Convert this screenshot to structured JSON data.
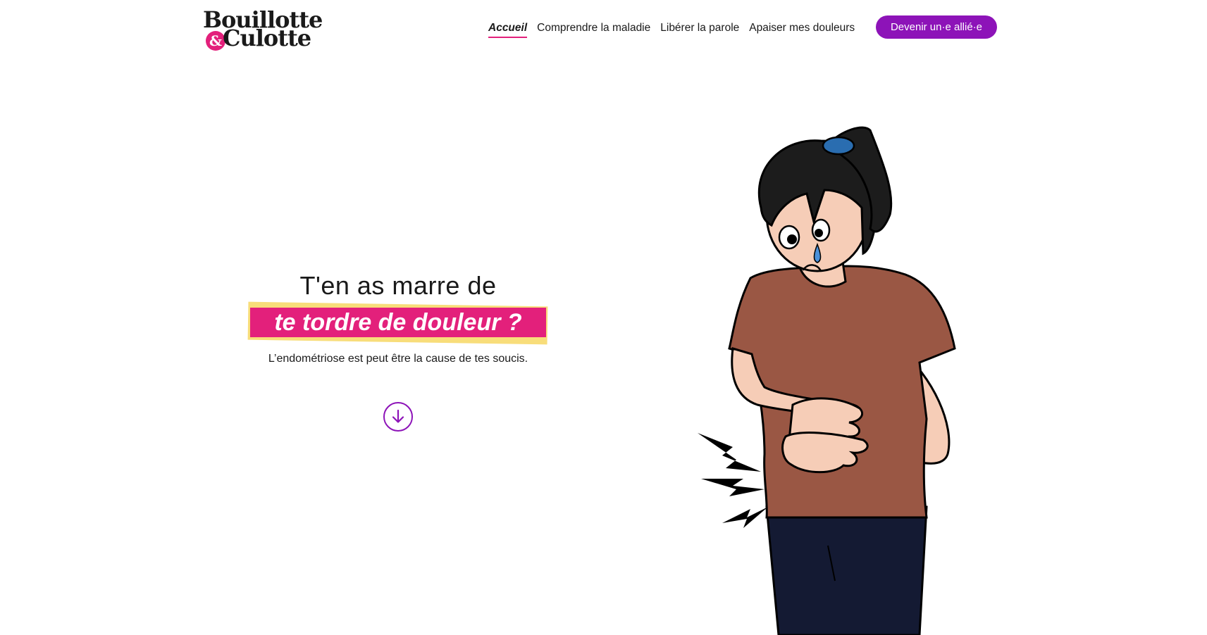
{
  "header": {
    "logo": {
      "line1": "Bouillotte",
      "amp": "&",
      "line2": "Culotte"
    },
    "nav": [
      {
        "label": "Accueil",
        "active": true
      },
      {
        "label": "Comprendre la maladie",
        "active": false
      },
      {
        "label": "Libérer la parole",
        "active": false
      },
      {
        "label": "Apaiser mes douleurs",
        "active": false
      }
    ],
    "cta_label": "Devenir un·e allié·e"
  },
  "hero": {
    "line1": "T'en as marre de",
    "highlight": "te tordre de douleur ?",
    "subtitle": "L’endométriose est peut être la cause de tes soucis.",
    "scroll_icon": "arrow-down-circle-icon"
  },
  "illustration": {
    "icon": "woman-stomach-pain-illustration"
  },
  "colors": {
    "accent_pink": "#e3207b",
    "accent_purple": "#8d13b8",
    "highlight_yellow": "#f8dd7a",
    "shirt_brown": "#9a5744",
    "pants_navy": "#141a33"
  }
}
